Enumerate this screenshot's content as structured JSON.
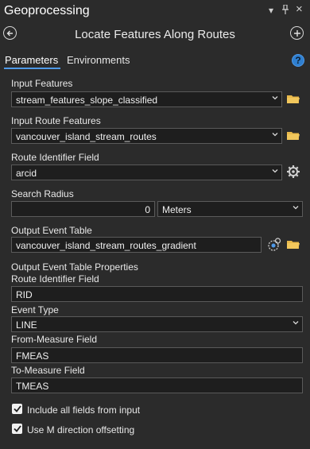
{
  "window": {
    "title": "Geoprocessing",
    "pin_glyph": "▾",
    "auto_hide_glyph": "ꟷ",
    "close_glyph": "×"
  },
  "header": {
    "back_icon": "back-arrow-icon",
    "tool_title": "Locate Features Along Routes",
    "add_icon": "plus-icon"
  },
  "tabs": [
    {
      "label": "Parameters",
      "active": true
    },
    {
      "label": "Environments",
      "active": false
    }
  ],
  "help_label": "?",
  "params": {
    "input_features": {
      "label": "Input Features",
      "value": "stream_features_slope_classified"
    },
    "input_routes": {
      "label": "Input Route Features",
      "value": "vancouver_island_stream_routes"
    },
    "route_id_field": {
      "label": "Route Identifier Field",
      "value": "arcid"
    },
    "search_radius": {
      "label": "Search Radius",
      "value": "0",
      "unit": "Meters"
    },
    "output_table": {
      "label": "Output Event Table",
      "value": "vancouver_island_stream_routes_gradient"
    },
    "props_heading": "Output Event Table Properties",
    "event_route_id": {
      "label": "Route Identifier Field",
      "value": "RID"
    },
    "event_type": {
      "label": "Event Type",
      "value": "LINE"
    },
    "from_measure": {
      "label": "From-Measure Field",
      "value": "FMEAS"
    },
    "to_measure": {
      "label": "To-Measure Field",
      "value": "TMEAS"
    }
  },
  "checkboxes": [
    {
      "label": "Include all fields from input",
      "checked": true
    },
    {
      "label": "Use M direction offsetting",
      "checked": true
    }
  ],
  "colors": {
    "background": "#2b2b2b",
    "field_bg": "#1e1e1e",
    "accent": "#4f9ae8",
    "folder": "#e8b84a"
  }
}
